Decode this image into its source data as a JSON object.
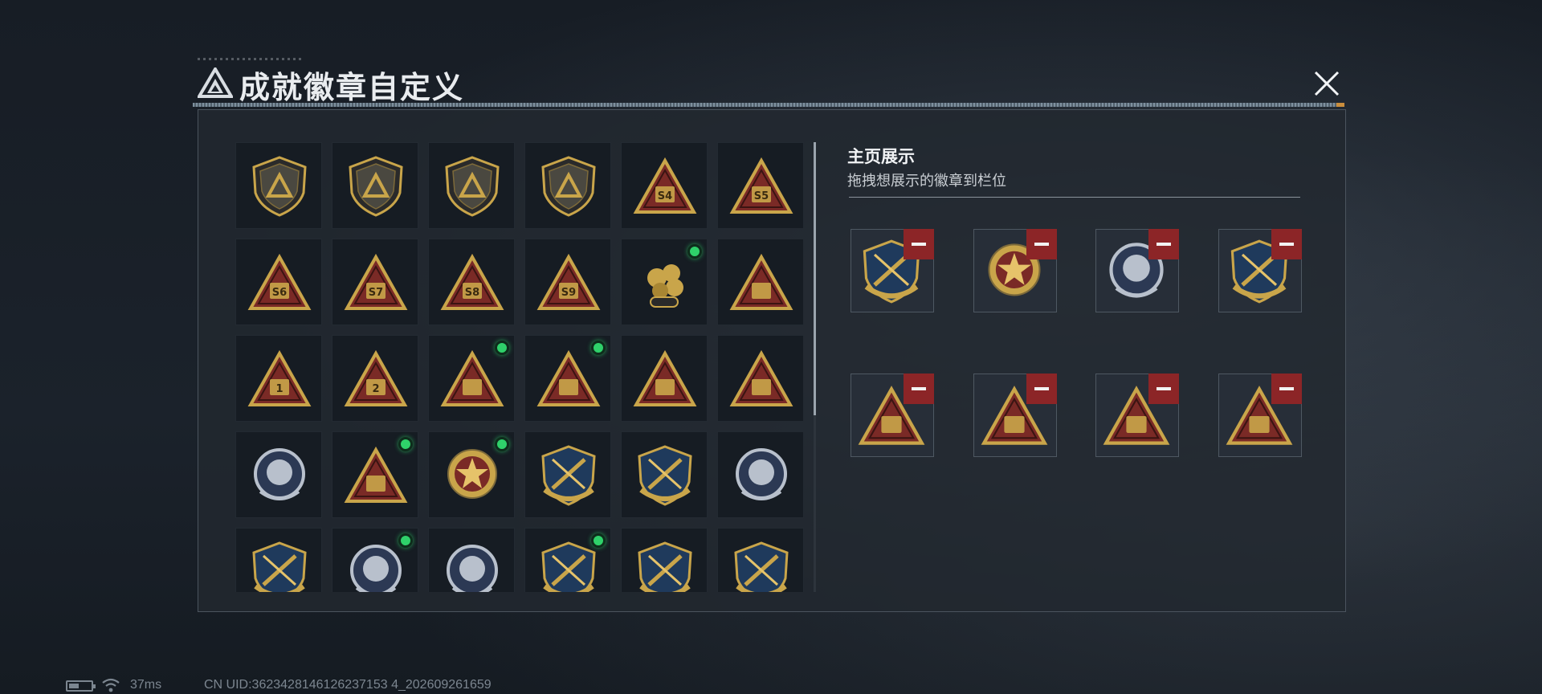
{
  "header": {
    "title": "成就徽章自定义",
    "logo_icon": "triangle-emblem-icon",
    "close_icon": "close-icon"
  },
  "showcase": {
    "title": "主页展示",
    "subtitle": "拖拽想展示的徽章到栏位",
    "slots": [
      {
        "icon": "shield-crossed-rifles-badge",
        "remove_icon": "minus-icon"
      },
      {
        "icon": "star-medal-badge",
        "remove_icon": "minus-icon"
      },
      {
        "icon": "silver-skull-laurel-badge",
        "remove_icon": "minus-icon"
      },
      {
        "icon": "shield-crossed-rifles-badge",
        "remove_icon": "minus-icon"
      },
      {
        "icon": "gold-cluster-triangle-badge",
        "remove_icon": "minus-icon"
      },
      {
        "icon": "triangle-usb-badge",
        "remove_icon": "minus-icon"
      },
      {
        "icon": "triangle-hands-badge",
        "remove_icon": "minus-icon"
      },
      {
        "icon": "triangle-diver-badge",
        "remove_icon": "minus-icon"
      }
    ]
  },
  "badges": [
    {
      "icon": "shield-triangle-badge",
      "label": "",
      "new": false
    },
    {
      "icon": "shield-helicopter-badge",
      "label": "",
      "new": false
    },
    {
      "icon": "shield-diamond-badge",
      "label": "",
      "new": false
    },
    {
      "icon": "shield-blade-badge",
      "label": "",
      "new": false
    },
    {
      "icon": "triangle-s4-badge",
      "label": "S4",
      "new": false
    },
    {
      "icon": "triangle-s5-badge",
      "label": "S5",
      "new": false
    },
    {
      "icon": "triangle-s6-badge",
      "label": "S6",
      "new": false
    },
    {
      "icon": "triangle-s7-badge",
      "label": "S7",
      "new": false
    },
    {
      "icon": "triangle-s8-badge",
      "label": "S8",
      "new": false
    },
    {
      "icon": "triangle-s9-badge",
      "label": "S9",
      "new": false
    },
    {
      "icon": "gold-cluster-badge",
      "label": "",
      "new": true
    },
    {
      "icon": "triangle-hat-badge",
      "label": "",
      "new": false
    },
    {
      "icon": "triangle-one-badge",
      "label": "1",
      "new": false
    },
    {
      "icon": "triangle-two-badge",
      "label": "2",
      "new": false
    },
    {
      "icon": "triangle-usb-badge",
      "label": "",
      "new": true
    },
    {
      "icon": "triangle-hands-badge",
      "label": "",
      "new": true
    },
    {
      "icon": "triangle-soldiers-badge",
      "label": "",
      "new": false
    },
    {
      "icon": "triangle-rocket-badge",
      "label": "",
      "new": false
    },
    {
      "icon": "silver-diamond-rose-badge",
      "label": "",
      "new": false
    },
    {
      "icon": "triangle-diver-badge",
      "label": "",
      "new": true
    },
    {
      "icon": "star-medal-badge",
      "label": "",
      "new": true
    },
    {
      "icon": "shield-gold-crest-badge",
      "label": "",
      "new": false
    },
    {
      "icon": "gold-wing-shield-badge",
      "label": "",
      "new": false
    },
    {
      "icon": "silver-gem-shield-badge",
      "label": "",
      "new": false
    },
    {
      "icon": "skull-target-badge",
      "label": "",
      "new": false
    },
    {
      "icon": "silver-skull-laurel-badge",
      "label": "",
      "new": true
    },
    {
      "icon": "silver-tank-star-badge",
      "label": "",
      "new": false
    },
    {
      "icon": "shield-crossed-rifles-badge",
      "label": "",
      "new": true
    },
    {
      "icon": "green-rifle-shield-badge",
      "label": "",
      "new": false
    },
    {
      "icon": "bronze-sabre-badge",
      "label": "",
      "new": false
    }
  ],
  "status_bar": {
    "battery_icon": "battery-icon",
    "wifi_icon": "wifi-icon",
    "ping": "37ms",
    "uid": "CN UID:3623428146126237153 4_202609261659"
  },
  "colors": {
    "gold": "#c9a54a",
    "maroon": "#7a2a26",
    "silver": "#b8c0cc",
    "new_dot": "#2fd16a",
    "remove": "#8c2527"
  }
}
